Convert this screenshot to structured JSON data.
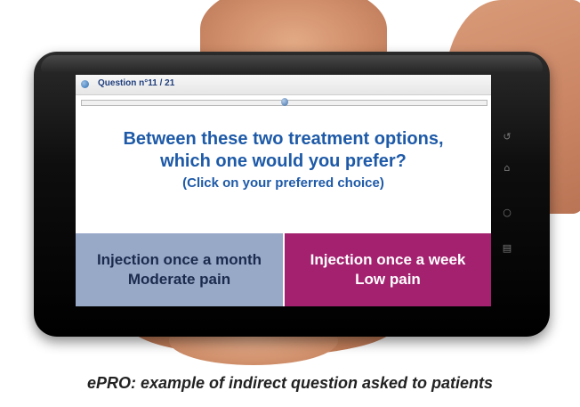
{
  "progress": {
    "label": "Question n°11 / 21",
    "current": 11,
    "total": 21
  },
  "question": {
    "line1": "Between these two treatment options,",
    "line2": "which one would you prefer?",
    "instruction": "(Click on your preferred choice)"
  },
  "choices": [
    {
      "line1": "Injection once a month",
      "line2": "Moderate pain",
      "color": "#98a8c7"
    },
    {
      "line1": "Injection once a week",
      "line2": "Low pain",
      "color": "#a3216f"
    }
  ],
  "device_buttons": [
    {
      "icon": "back-icon",
      "glyph": "↺"
    },
    {
      "icon": "home-icon",
      "glyph": "⌂"
    },
    {
      "icon": "search-icon",
      "glyph": "○"
    },
    {
      "icon": "menu-icon",
      "glyph": "▤"
    }
  ],
  "caption": "ePRO: example of indirect question asked to patients",
  "colors": {
    "question_text": "#1e5aa8",
    "header_text": "#1f3e7c"
  }
}
